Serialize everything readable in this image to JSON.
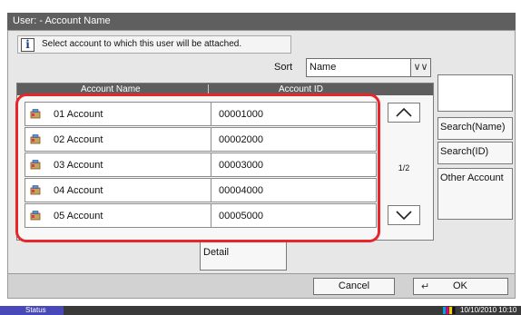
{
  "window": {
    "title": "User: - Account Name"
  },
  "message": {
    "text": "Select account to which this user will be attached."
  },
  "sort": {
    "label": "Sort",
    "value": "Name"
  },
  "table": {
    "columns": [
      "Account Name",
      "Account ID"
    ],
    "rows": [
      {
        "name": "01  Account",
        "id": "00001000"
      },
      {
        "name": "02  Account",
        "id": "00002000"
      },
      {
        "name": "03  Account",
        "id": "00003000"
      },
      {
        "name": "04  Account",
        "id": "00004000"
      },
      {
        "name": "05  Account",
        "id": "00005000"
      }
    ],
    "page": "1/2"
  },
  "side": {
    "search_value": "",
    "search_name_label": "Search(Name)",
    "search_id_label": "Search(ID)",
    "other_account_label": "Other Account"
  },
  "detail_label": "Detail",
  "footer": {
    "cancel_label": "Cancel",
    "ok_label": "OK"
  },
  "status": {
    "label": "Status",
    "datetime": "10/10/2010  10:10"
  },
  "colors": {
    "highlight": "#e6262b",
    "titlebar": "#5f5f5f",
    "status_button": "#4848b8"
  },
  "icons": {
    "info": "info-icon",
    "account": "account-icon",
    "scroll_up": "chevron-up-icon",
    "scroll_down": "chevron-down-icon",
    "enter": "enter-icon",
    "toner": "toner-icon"
  }
}
